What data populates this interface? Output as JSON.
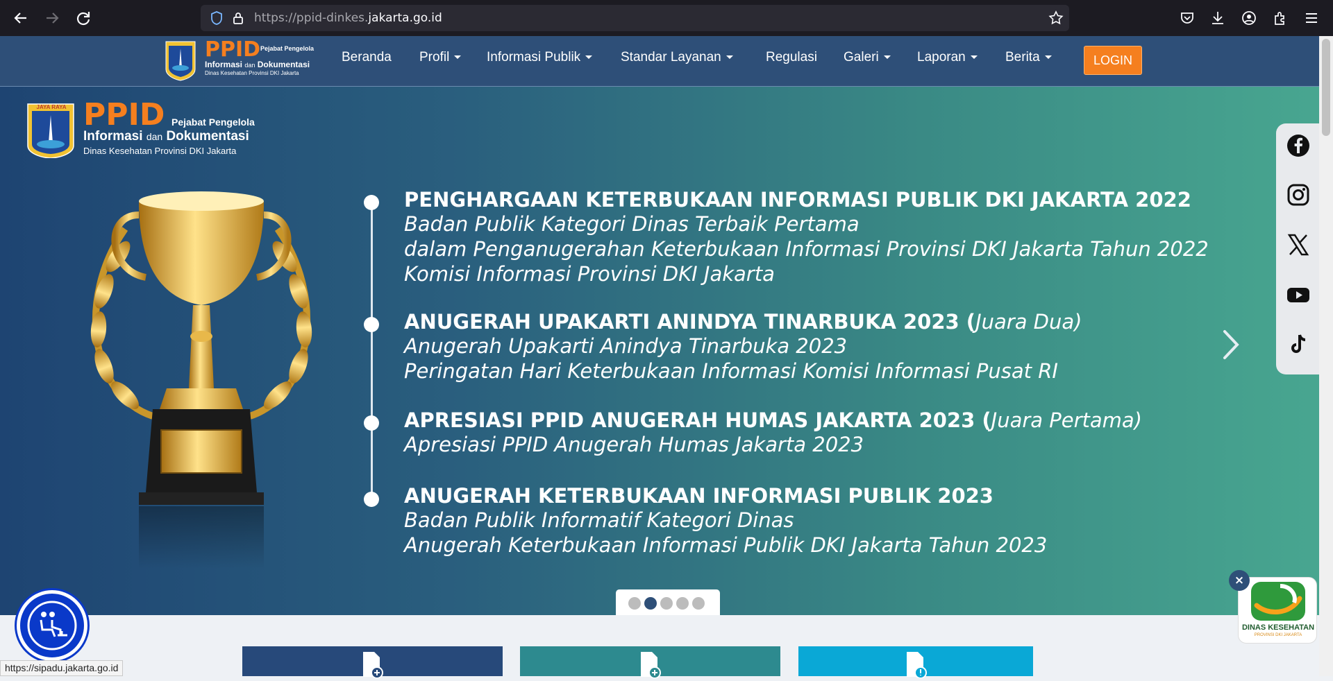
{
  "browser": {
    "url_prefix": "https://ppid-dinkes.",
    "url_domain": "jakarta.go.id"
  },
  "header": {
    "logo_title": "PPID",
    "logo_sub1": "Pejabat Pengelola",
    "logo_sub2a": "Informasi",
    "logo_sub2b": "dan",
    "logo_sub2c": "Dokumentasi",
    "logo_sub3": "Dinas Kesehatan Provinsi DKI Jakarta",
    "logo_seal": "JAYA RAYA",
    "menu": [
      {
        "label": "Beranda"
      },
      {
        "label": "Profil"
      },
      {
        "label": "Informasi Publik"
      },
      {
        "label": "Standar Layanan"
      },
      {
        "label": "Regulasi"
      },
      {
        "label": "Galeri"
      },
      {
        "label": "Laporan"
      },
      {
        "label": "Berita"
      }
    ],
    "login_label": "LOGIN"
  },
  "hero": {
    "awards": [
      {
        "title": "PENGHARGAAN KETERBUKAAN INFORMASI PUBLIK DKI JAKARTA 2022",
        "title_note": "",
        "lines": [
          "Badan Publik Kategori Dinas Terbaik Pertama",
          "dalam Penganugerahan Keterbukaan Informasi Provinsi DKI Jakarta Tahun 2022",
          "Komisi Informasi Provinsi DKI Jakarta"
        ]
      },
      {
        "title": "ANUGERAH UPAKARTI ANINDYA TINARBUKA 2023 (",
        "title_note": "Juara Dua)",
        "lines": [
          "Anugerah Upakarti Anindya Tinarbuka 2023",
          "Peringatan Hari Keterbukaan Informasi Komisi Informasi Pusat RI"
        ]
      },
      {
        "title": "APRESIASI PPID ANUGERAH HUMAS JAKARTA 2023 (",
        "title_note": "Juara Pertama)",
        "lines": [
          "Apresiasi PPID Anugerah Humas Jakarta 2023"
        ]
      },
      {
        "title": "ANUGERAH KETERBUKAAN INFORMASI PUBLIK 2023",
        "title_note": "",
        "lines": [
          "Badan Publik Informatif Kategori Dinas",
          "Anugerah Keterbukaan Informasi Publik DKI Jakarta Tahun 2023"
        ]
      }
    ],
    "carousel_active_index": 1,
    "carousel_count": 5
  },
  "social": [
    "facebook-icon",
    "instagram-icon",
    "x-icon",
    "youtube-icon",
    "tiktok-icon"
  ],
  "status_url": "https://sipadu.jakarta.go.id",
  "dinkes_badge": {
    "label": "DINAS KESEHATAN",
    "sub": "PROVINSI DKI JAKARTA",
    "close": "×"
  },
  "colors": {
    "header": "#2e4f78",
    "accent": "#f57f1f",
    "card1": "#27497a",
    "card2": "#2d8a8f",
    "card3": "#0aa8d6"
  }
}
